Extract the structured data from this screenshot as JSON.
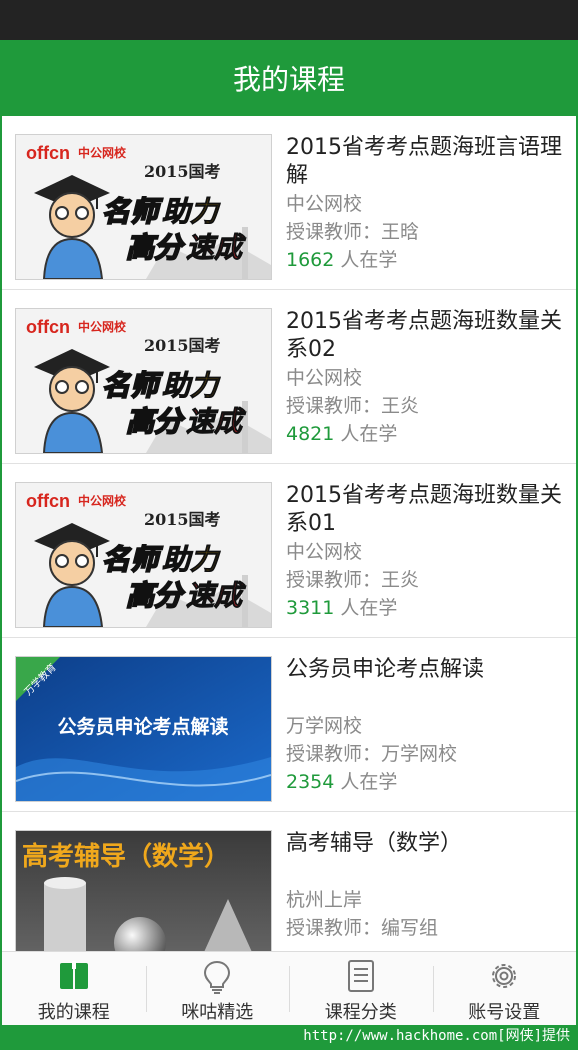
{
  "header": {
    "title": "我的课程"
  },
  "courses": [
    {
      "title": "2015省考考点题海班言语理解",
      "provider": "中公网校",
      "teacher": "授课教师：王晗",
      "count": "1662",
      "count_suffix": " 人在学",
      "thumb": {
        "brand": "中公网校",
        "logo": "offcn",
        "year": "2015国考",
        "line1a": "名师",
        "line1b": "助力",
        "line2a": "高分",
        "line2b": "速成"
      }
    },
    {
      "title": "2015省考考点题海班数量关系02",
      "provider": "中公网校",
      "teacher": "授课教师：王炎",
      "count": "4821",
      "count_suffix": " 人在学",
      "thumb": {
        "brand": "中公网校",
        "logo": "offcn",
        "year": "2015国考",
        "line1a": "名师",
        "line1b": "助力",
        "line2a": "高分",
        "line2b": "速成"
      }
    },
    {
      "title": "2015省考考点题海班数量关系01",
      "provider": "中公网校",
      "teacher": "授课教师：王炎",
      "count": "3311",
      "count_suffix": " 人在学",
      "thumb": {
        "brand": "中公网校",
        "logo": "offcn",
        "year": "2015国考",
        "line1a": "名师",
        "line1b": "助力",
        "line2a": "高分",
        "line2b": "速成"
      }
    },
    {
      "title": "公务员申论考点解读",
      "provider": "万学网校",
      "teacher": "授课教师：万学网校",
      "count": "2354",
      "count_suffix": " 人在学",
      "thumb": {
        "banner": "公务员申论考点解读",
        "ribbon": "万学教育"
      }
    },
    {
      "title": "高考辅导（数学）",
      "provider": "杭州上岸",
      "teacher": "授课教师：编写组",
      "count": "",
      "count_suffix": "",
      "thumb": {
        "banner": "高考辅导（数学）"
      }
    }
  ],
  "tabs": [
    {
      "label": "我的课程",
      "icon": "book-icon",
      "active": true
    },
    {
      "label": "咪咕精选",
      "icon": "lightbulb-icon",
      "active": false
    },
    {
      "label": "课程分类",
      "icon": "list-icon",
      "active": false
    },
    {
      "label": "账号设置",
      "icon": "gear-icon",
      "active": false
    }
  ],
  "colors": {
    "brand_green": "#1f9a3b",
    "status_bar": "#232323",
    "muted_text": "#8a8a8a"
  },
  "watermark": "http://www.hackhome.com[网侠]提供"
}
